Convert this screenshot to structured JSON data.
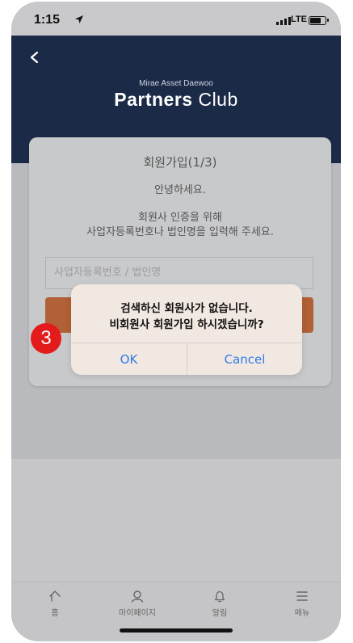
{
  "status_bar": {
    "time": "1:15",
    "network": "LTE"
  },
  "header": {
    "brand_small": "Mirae Asset Daewoo",
    "brand_big_1": "Partners",
    "brand_big_2": "Club"
  },
  "card": {
    "title": "회원가입(1/3)",
    "greeting": "안녕하세요.",
    "desc_line1": "회원사 인증을 위해",
    "desc_line2": "사업자등록번호나 법인명을 입력해 주세요.",
    "input_placeholder": "사업자등록번호 / 법인명"
  },
  "alert": {
    "message_line1": "검색하신 회원사가 없습니다.",
    "message_line2": "비회원사 회원가입 하시겠습니까?",
    "ok_label": "OK",
    "cancel_label": "Cancel"
  },
  "step_badge": "3",
  "tabbar": [
    {
      "label": "홈",
      "icon": "home-icon"
    },
    {
      "label": "마이페이지",
      "icon": "person-icon"
    },
    {
      "label": "알림",
      "icon": "bell-icon"
    },
    {
      "label": "메뉴",
      "icon": "menu-icon"
    }
  ],
  "colors": {
    "header_bg": "#1b2a47",
    "accent_button": "#b26035",
    "alert_button_text": "#2f7be6",
    "step_badge": "#e31b1b"
  }
}
